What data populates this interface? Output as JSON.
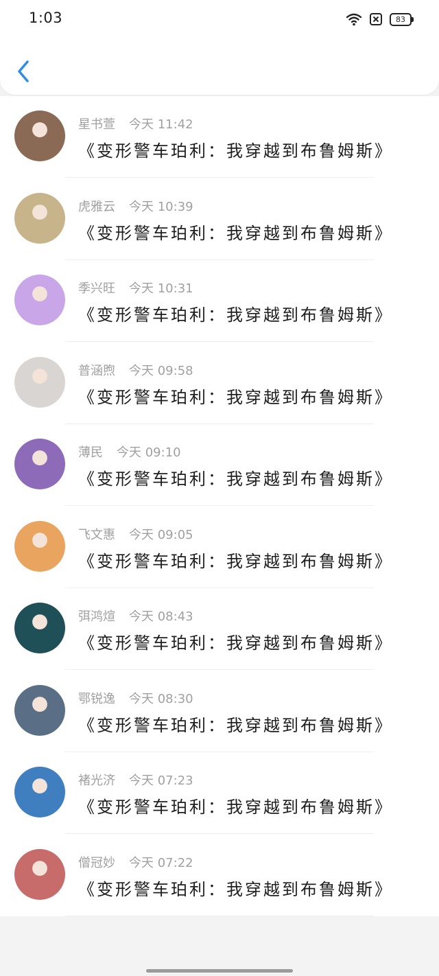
{
  "status": {
    "time": "1:03",
    "battery": "83"
  },
  "header": {
    "back_icon": "chevron-left-icon"
  },
  "comments": [
    {
      "name": "星书萱",
      "time": "今天 11:42",
      "text": "《变形警车珀利：我穿越到布鲁姆斯》",
      "avatar_color": "#8b6a55"
    },
    {
      "name": "虎雅云",
      "time": "今天 10:39",
      "text": "《变形警车珀利：我穿越到布鲁姆斯》",
      "avatar_color": "#c8b48a"
    },
    {
      "name": "季兴旺",
      "time": "今天 10:31",
      "text": "《变形警车珀利：我穿越到布鲁姆斯》",
      "avatar_color": "#c9a6e8"
    },
    {
      "name": "普涵煦",
      "time": "今天 09:58",
      "text": "《变形警车珀利：我穿越到布鲁姆斯》",
      "avatar_color": "#d9d5d2"
    },
    {
      "name": "薄民",
      "time": "今天 09:10",
      "text": "《变形警车珀利：我穿越到布鲁姆斯》",
      "avatar_color": "#8e6bb8"
    },
    {
      "name": "飞文惠",
      "time": "今天 09:05",
      "text": "《变形警车珀利：我穿越到布鲁姆斯》",
      "avatar_color": "#e9a55f"
    },
    {
      "name": "弭鸿煊",
      "time": "今天 08:43",
      "text": "《变形警车珀利：我穿越到布鲁姆斯》",
      "avatar_color": "#1f4f57"
    },
    {
      "name": "鄂锐逸",
      "time": "今天 08:30",
      "text": "《变形警车珀利：我穿越到布鲁姆斯》",
      "avatar_color": "#5a6f86"
    },
    {
      "name": "褚光济",
      "time": "今天 07:23",
      "text": "《变形警车珀利：我穿越到布鲁姆斯》",
      "avatar_color": "#3f7fc0"
    },
    {
      "name": "僧冠妙",
      "time": "今天 07:22",
      "text": "《变形警车珀利：我穿越到布鲁姆斯》",
      "avatar_color": "#c86b6b"
    }
  ]
}
